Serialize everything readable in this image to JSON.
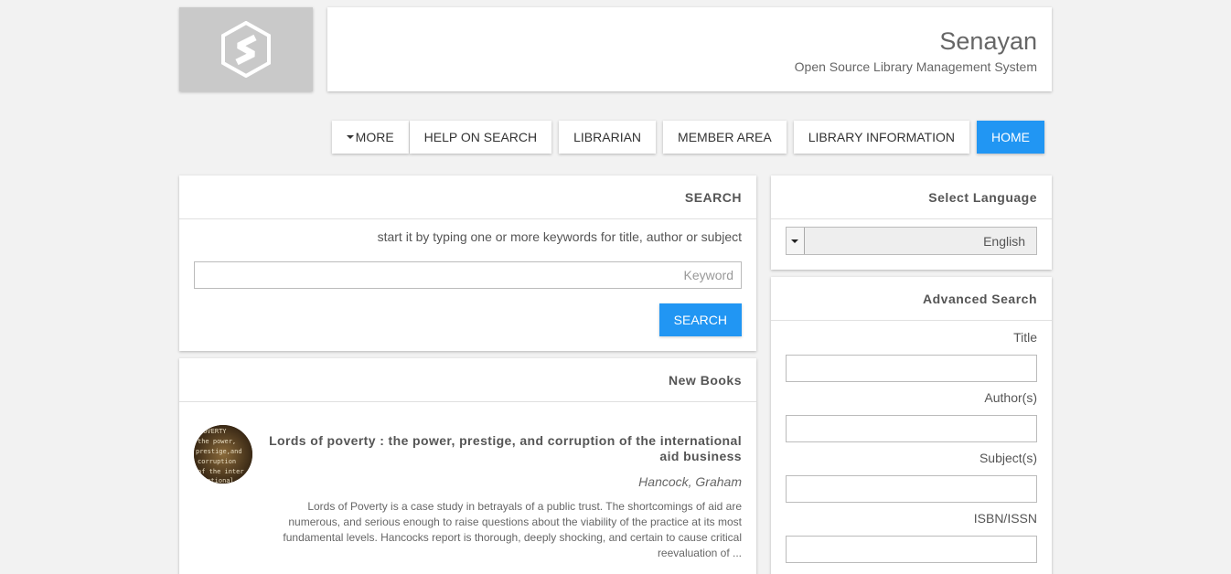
{
  "brand": {
    "title": "Senayan",
    "subtitle": "Open Source Library Management System",
    "logo_icon": "slims-hexagon-logo"
  },
  "nav": {
    "more": "MORE",
    "help": "HELP ON SEARCH",
    "librarian": "LIBRARIAN",
    "member": "MEMBER AREA",
    "info": "LIBRARY INFORMATION",
    "home": "HOME"
  },
  "search": {
    "heading": "SEARCH",
    "hint": "start it by typing one or more keywords for title, author or subject",
    "placeholder": "Keyword",
    "button": "SEARCH"
  },
  "new_books": {
    "heading": "New Books",
    "items": [
      {
        "title": "Lords of poverty : the power, prestige, and corruption of the international aid business",
        "author": "Hancock, Graham",
        "description": "Lords of Poverty is a case study in betrayals of a public trust. The shortcomings of aid are numerous, and serious enough to raise questions about the viability of the practice at its most fundamental levels. Hancocks report is thorough, deeply shocking, and certain to cause critical reevaluation of ..."
      }
    ]
  },
  "language": {
    "heading": "Select Language",
    "selected": "English"
  },
  "advanced": {
    "heading": "Advanced Search",
    "title_label": "Title",
    "author_label": "Author(s)",
    "subject_label": "Subject(s)",
    "isbn_label": "ISBN/ISSN"
  },
  "colors": {
    "accent": "#2196f3",
    "background": "#f2f2f2"
  }
}
